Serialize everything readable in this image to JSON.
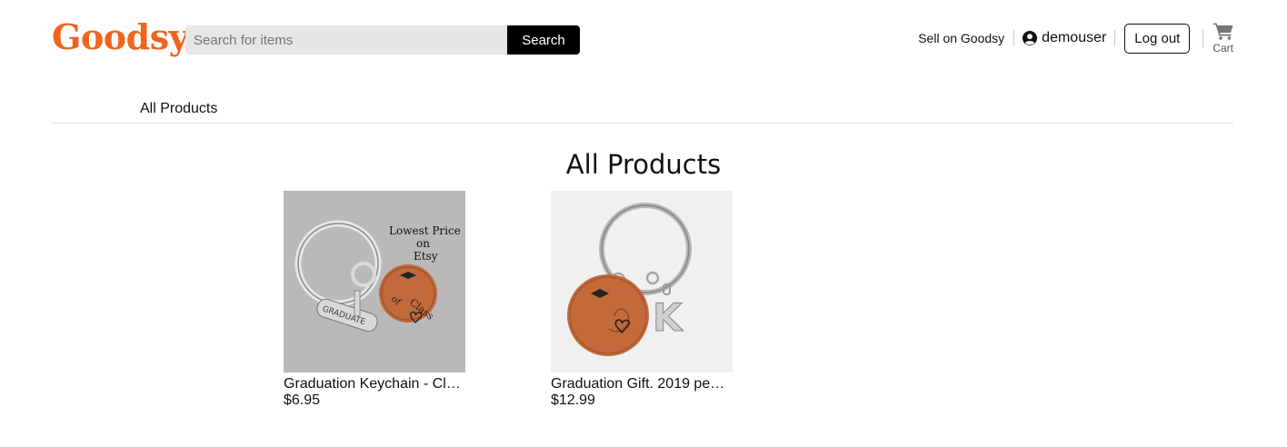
{
  "header": {
    "logo": "Goodsy",
    "search": {
      "placeholder": "Search for items",
      "value": "",
      "button_label": "Search"
    },
    "sell_link": "Sell on Goodsy",
    "username": "demouser",
    "logout_label": "Log out",
    "cart_label": "Cart"
  },
  "subnav": {
    "items": [
      {
        "label": "All Products"
      }
    ]
  },
  "main": {
    "title": "All Products",
    "products": [
      {
        "title": "Graduation Keychain - Cl…",
        "price": "$6.95",
        "image_text": [
          "Lowest Price",
          "on",
          "Etsy"
        ]
      },
      {
        "title": "Graduation Gift. 2019 pe…",
        "price": "$12.99",
        "image_text": [
          "K"
        ]
      }
    ]
  },
  "colors": {
    "brand": "#f1641e",
    "button_dark": "#000000",
    "search_bg": "#e6e6e6"
  }
}
